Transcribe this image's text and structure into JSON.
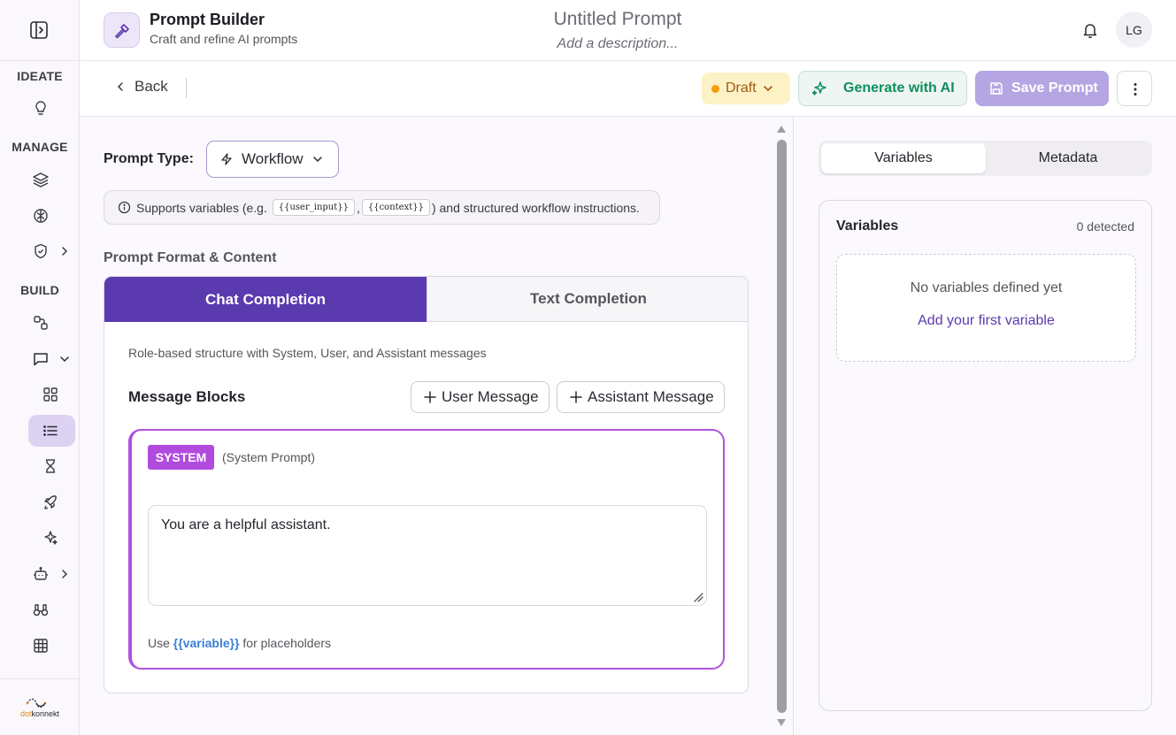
{
  "sidebar": {
    "sections": {
      "ideate": "IDEATE",
      "manage": "MANAGE",
      "build": "BUILD"
    },
    "brand": {
      "prefix": "dot",
      "suffix": "konnekt"
    }
  },
  "header": {
    "app_title": "Prompt Builder",
    "app_subtitle": "Craft and refine AI prompts",
    "doc_title": "Untitled Prompt",
    "doc_description": "Add a description...",
    "avatar_initials": "LG"
  },
  "toolbar": {
    "back_label": "Back",
    "status_label": "Draft",
    "generate_label": "Generate with AI",
    "save_label": "Save Prompt"
  },
  "prompt_type": {
    "label": "Prompt Type:",
    "selected": "Workflow",
    "info_prefix": "Supports variables (e.g.",
    "info_var1": "{{user_input}}",
    "info_sep": ",",
    "info_var2": "{{context}}",
    "info_suffix": ") and structured workflow instructions."
  },
  "format": {
    "section_label": "Prompt Format & Content",
    "tabs": [
      {
        "label": "Chat Completion",
        "active": true
      },
      {
        "label": "Text Completion",
        "active": false
      }
    ],
    "description": "Role-based structure with System, User, and Assistant messages",
    "blocks_label": "Message Blocks",
    "add_user_label": "User Message",
    "add_assistant_label": "Assistant Message"
  },
  "system_block": {
    "badge": "SYSTEM",
    "subtitle": "(System Prompt)",
    "content": "You are a helpful assistant.",
    "hint_prefix": "Use",
    "hint_var": "{{variable}}",
    "hint_suffix": "for placeholders"
  },
  "right_panel": {
    "tabs": [
      {
        "label": "Variables",
        "active": true
      },
      {
        "label": "Metadata",
        "active": false
      }
    ],
    "variables_title": "Variables",
    "detected_count": "0 detected",
    "empty_message": "No variables defined yet",
    "add_first_label": "Add your first variable"
  },
  "colors": {
    "accent": "#5b3ab0",
    "system_badge": "#b14be0",
    "draft_dot": "#f59e0b",
    "generate_text": "#0f8f5b",
    "save_bg": "#b5a5e2"
  }
}
